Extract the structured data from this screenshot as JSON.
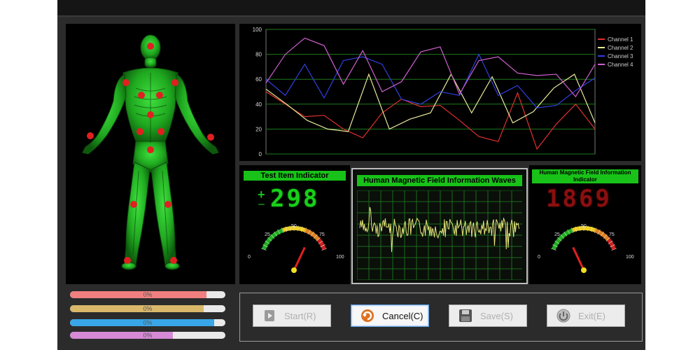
{
  "test_item": {
    "title": "Test Item Indicator",
    "plus": "+",
    "minus": "−",
    "value": "298",
    "gauge": {
      "min_label": "0",
      "l25": "25",
      "l50": "50",
      "l75": "75",
      "max_label": "100",
      "level": 68
    }
  },
  "wave_panel": {
    "title": "Human Magnetic Field Information Waves"
  },
  "info_panel": {
    "title": "Human Magnetic Field Information Indicator",
    "value": "1869",
    "gauge": {
      "min_label": "0",
      "l25": "25",
      "l50": "50",
      "l75": "75",
      "max_label": "100",
      "level": 32
    }
  },
  "sliders": [
    {
      "label": "0%",
      "fill": 0.88,
      "color": "#f08080"
    },
    {
      "label": "0%",
      "fill": 0.86,
      "color": "#d9b86a"
    },
    {
      "label": "0%",
      "fill": 0.93,
      "color": "#39a6e8"
    },
    {
      "label": "0%",
      "fill": 0.66,
      "color": "#d68ad6"
    }
  ],
  "buttons": [
    {
      "label": "Start(R)",
      "icon": "start-icon",
      "enabled": false
    },
    {
      "label": "Cancel(C)",
      "icon": "cancel-icon",
      "enabled": true
    },
    {
      "label": "Save(S)",
      "icon": "save-icon",
      "enabled": false
    },
    {
      "label": "Exit(E)",
      "icon": "exit-icon",
      "enabled": false
    }
  ],
  "chart_data": {
    "type": "line",
    "ylim": [
      0,
      100
    ],
    "yticks": [
      0,
      20,
      40,
      60,
      80,
      100
    ],
    "x": [
      0,
      1,
      2,
      3,
      4,
      5,
      6,
      7,
      8,
      9,
      10,
      11,
      12,
      13,
      14,
      15,
      16,
      17,
      18,
      19,
      20,
      21,
      22
    ],
    "grid": true,
    "legend_position": "top-right",
    "series": [
      {
        "name": "Channel 1",
        "color": "#e03030",
        "values": [
          50,
          40,
          30,
          31,
          20,
          13,
          33,
          44,
          38,
          39,
          27,
          14,
          10,
          49,
          4,
          24,
          40,
          20,
          19,
          0,
          0,
          0,
          0
        ]
      },
      {
        "name": "Channel 2",
        "color": "#e8e89a",
        "values": [
          52,
          40,
          27,
          20,
          18,
          64,
          20,
          28,
          33,
          64,
          33,
          62,
          25,
          34,
          53,
          64,
          25,
          19,
          0,
          0,
          0,
          0,
          0
        ]
      },
      {
        "name": "Channel 3",
        "color": "#3040e0",
        "values": [
          60,
          47,
          72,
          45,
          75,
          78,
          72,
          44,
          40,
          50,
          47,
          80,
          47,
          55,
          37,
          39,
          51,
          61,
          33,
          0,
          0,
          0,
          0
        ]
      },
      {
        "name": "Channel 4",
        "color": "#d060d0",
        "values": [
          57,
          80,
          93,
          87,
          56,
          83,
          50,
          58,
          82,
          86,
          48,
          75,
          78,
          65,
          63,
          64,
          46,
          72,
          0,
          0,
          0,
          0,
          0
        ]
      }
    ]
  },
  "body_points_count": 17
}
